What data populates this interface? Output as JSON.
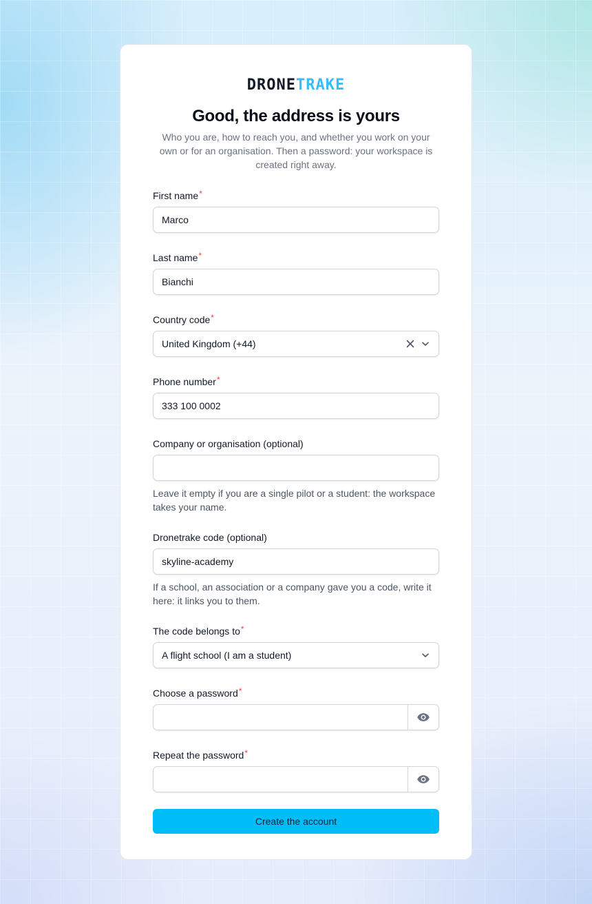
{
  "brand": {
    "part1": "DRONE",
    "part2": "TRAKE"
  },
  "heading": "Good, the address is yours",
  "subheading": "Who you are, how to reach you, and whether you work on your own or for an organisation. Then a password: your workspace is created right away.",
  "required_mark": "*",
  "fields": {
    "first_name": {
      "label": "First name",
      "value": "Marco"
    },
    "last_name": {
      "label": "Last name",
      "value": "Bianchi"
    },
    "country_code": {
      "label": "Country code",
      "value": "United Kingdom (+44)"
    },
    "phone": {
      "label": "Phone number",
      "value": "333 100 0002"
    },
    "company": {
      "label": "Company or organisation (optional)",
      "value": "",
      "help": "Leave it empty if you are a single pilot or a student: the workspace takes your name."
    },
    "code": {
      "label": "Dronetrake code (optional)",
      "value": "skyline-academy",
      "help": "If a school, an association or a company gave you a code, write it here: it links you to them."
    },
    "code_owner": {
      "label": "The code belongs to",
      "value": "A flight school (I am a student)"
    },
    "password": {
      "label": "Choose a password",
      "value": ""
    },
    "password_repeat": {
      "label": "Repeat the password",
      "value": ""
    }
  },
  "submit_label": "Create the account",
  "colors": {
    "accent": "#00bdf7",
    "brand_accent": "#38bdf8",
    "required": "#ef4444"
  },
  "icons": {
    "clear": "x-icon",
    "dropdown": "chevron-down-icon",
    "reveal": "eye-icon"
  }
}
